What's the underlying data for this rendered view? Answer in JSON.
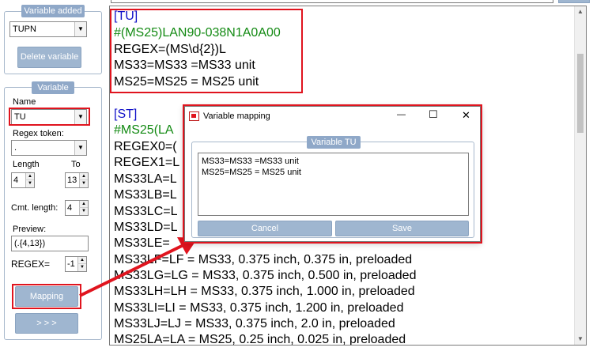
{
  "sidebar": {
    "variable_added": {
      "header": "Variable added",
      "selected": "TUPN",
      "delete_label": "Delete variable"
    },
    "variable": {
      "header": "Variable",
      "name_label": "Name",
      "name_value": "TU",
      "regex_token_label": "Regex token:",
      "regex_token_value": ".",
      "length_label": "Length",
      "length_value": "4",
      "to_label": "To",
      "to_value": "13",
      "cmt_length_label": "Cmt. length:",
      "cmt_length_value": "4",
      "preview_label": "Preview:",
      "preview_value": "(.{4,13})",
      "regex_label": "REGEX=",
      "regex_value": "-1",
      "mapping_label": "Mapping",
      "next_label": "> > >"
    }
  },
  "editor": {
    "lines": [
      "[TU]",
      "#(MS25)LAN90-038N1A0A00",
      "REGEX=(MS\\d{2})L",
      "MS33=MS33 =MS33 unit",
      "MS25=MS25 = MS25 unit",
      "[ST]",
      "#MS25(LA",
      "REGEX0=(",
      "REGEX1=L",
      "MS33LA=L",
      "MS33LB=L",
      "MS33LC=L",
      "MS33LD=L",
      "MS33LE=",
      "MS33LF=LF = MS33, 0.375 inch, 0.375 in, preloaded",
      "MS33LG=LG = MS33, 0.375 inch, 0.500 in, preloaded",
      "MS33LH=LH = MS33, 0.375 inch, 1.000 in, preloaded",
      "MS33LI=LI = MS33, 0.375 inch, 1.200 in, preloaded",
      "MS33LJ=LJ = MS33, 0.375 inch, 2.0 in, preloaded",
      "MS25LA=LA = MS25, 0.25 inch, 0.025 in, preloaded"
    ]
  },
  "dialog": {
    "title": "Variable mapping",
    "group_header": "Variable TU",
    "text_lines": [
      "MS33=MS33 =MS33 unit",
      "MS25=MS25 = MS25 unit"
    ],
    "cancel_label": "Cancel",
    "save_label": "Save",
    "minimize_glyph": "—",
    "maximize_glyph": "☐",
    "close_glyph": "✕"
  },
  "icons": {
    "combo_arrow": "▼",
    "spin_up": "▲",
    "spin_down": "▼",
    "scroll_up": "▲",
    "scroll_down": "▼"
  },
  "colors": {
    "highlight": "#e0141e",
    "section_blue": "#1010c8",
    "comment_green": "#138a13",
    "header_bg": "#8fa8c8",
    "button_bg": "#9fb6d0"
  }
}
